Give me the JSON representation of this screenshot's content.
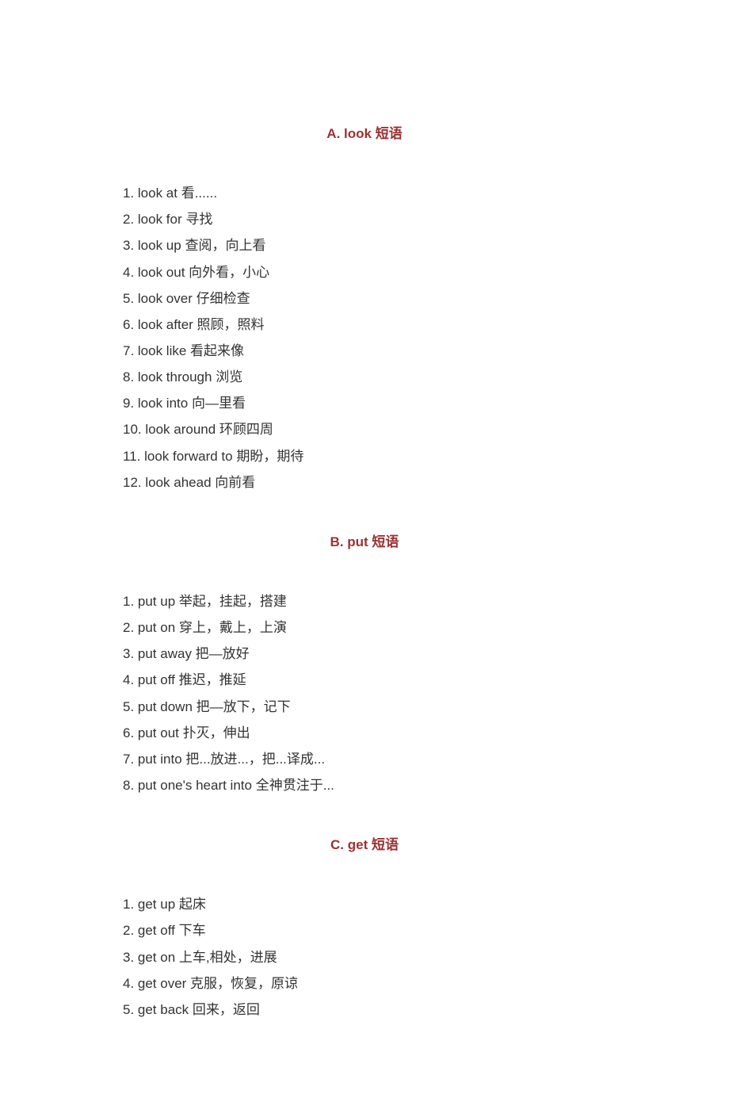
{
  "sections": [
    {
      "heading": "A. look 短语",
      "items": [
        "1. look at 看......",
        "2. look for 寻找",
        "3. look up 查阅，向上看",
        "4. look out 向外看，小心",
        "5. look over 仔细检查",
        "6. look after 照顾，照料",
        "7. look like 看起来像",
        "8. look through 浏览",
        "9. look into 向—里看",
        "10. look around 环顾四周",
        "11. look forward to 期盼，期待",
        "12. look ahead 向前看"
      ]
    },
    {
      "heading": "B. put 短语",
      "items": [
        "1. put up 举起，挂起，搭建",
        "2. put on 穿上，戴上，上演",
        "3. put away 把—放好",
        "4. put off 推迟，推延",
        "5. put down 把—放下，记下",
        "6. put out 扑灭，伸出",
        "7. put into 把...放进...，把...译成...",
        "8. put one's heart into 全神贯注于..."
      ]
    },
    {
      "heading": "C. get 短语",
      "items": [
        "1. get up 起床",
        "2. get off 下车",
        "3. get on 上车,相处，进展",
        "4. get over 克服，恢复，原谅",
        "5. get back 回来，返回"
      ]
    }
  ]
}
